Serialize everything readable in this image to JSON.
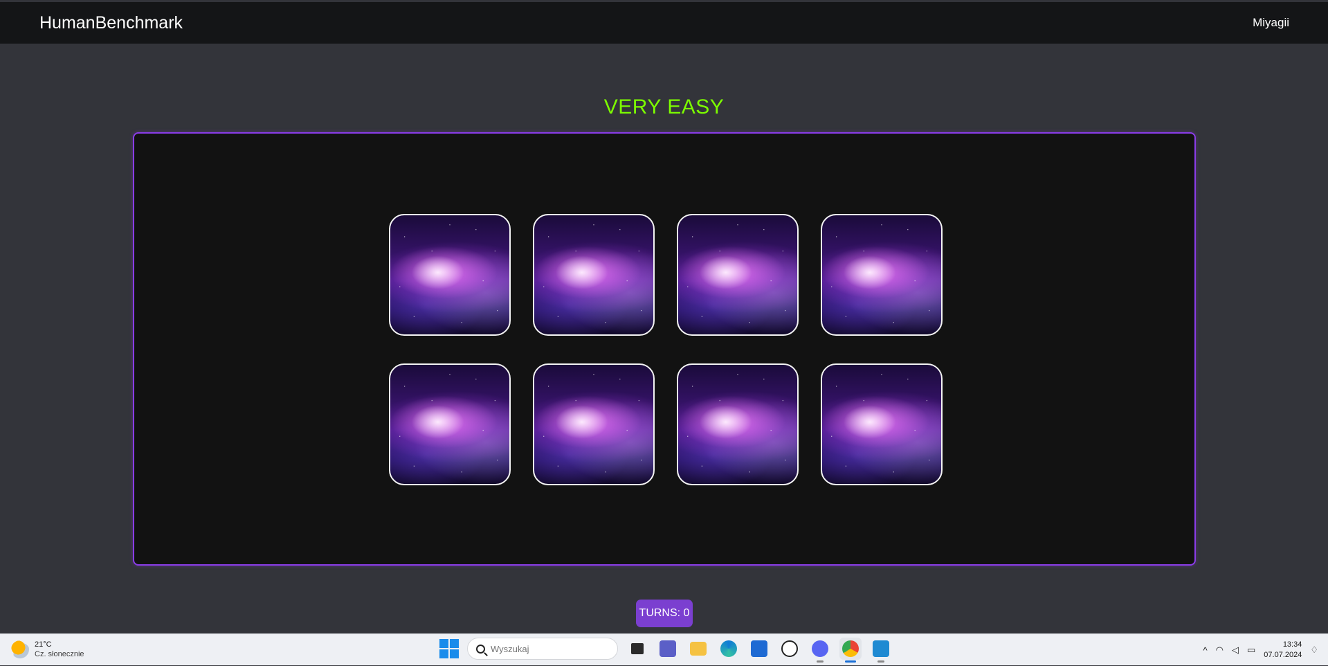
{
  "header": {
    "brand": "HumanBenchmark",
    "user": "Miyagii"
  },
  "game": {
    "difficulty": "VERY EASY",
    "turns_label": "TURNS: 0",
    "cards": [
      {
        "state": "face-down",
        "image": "galaxy-nebula"
      },
      {
        "state": "face-down",
        "image": "galaxy-nebula"
      },
      {
        "state": "face-down",
        "image": "galaxy-nebula"
      },
      {
        "state": "face-down",
        "image": "galaxy-nebula"
      },
      {
        "state": "face-down",
        "image": "galaxy-nebula"
      },
      {
        "state": "face-down",
        "image": "galaxy-nebula"
      },
      {
        "state": "face-down",
        "image": "galaxy-nebula"
      },
      {
        "state": "face-down",
        "image": "galaxy-nebula"
      }
    ],
    "colors": {
      "accent": "#8a3ce8",
      "difficulty": "#7cfc00",
      "turns_bg": "#7b3fd0"
    }
  },
  "taskbar": {
    "weather_temp": "21°C",
    "weather_desc": "Cz. słonecznie",
    "search_placeholder": "Wyszukaj",
    "apps": [
      "task-view-icon",
      "teams-icon",
      "file-explorer-icon",
      "edge-icon",
      "store-icon",
      "dell-icon",
      "discord-icon",
      "chrome-icon",
      "vscode-icon"
    ],
    "time": "13:34",
    "date": "07.07.2024"
  }
}
